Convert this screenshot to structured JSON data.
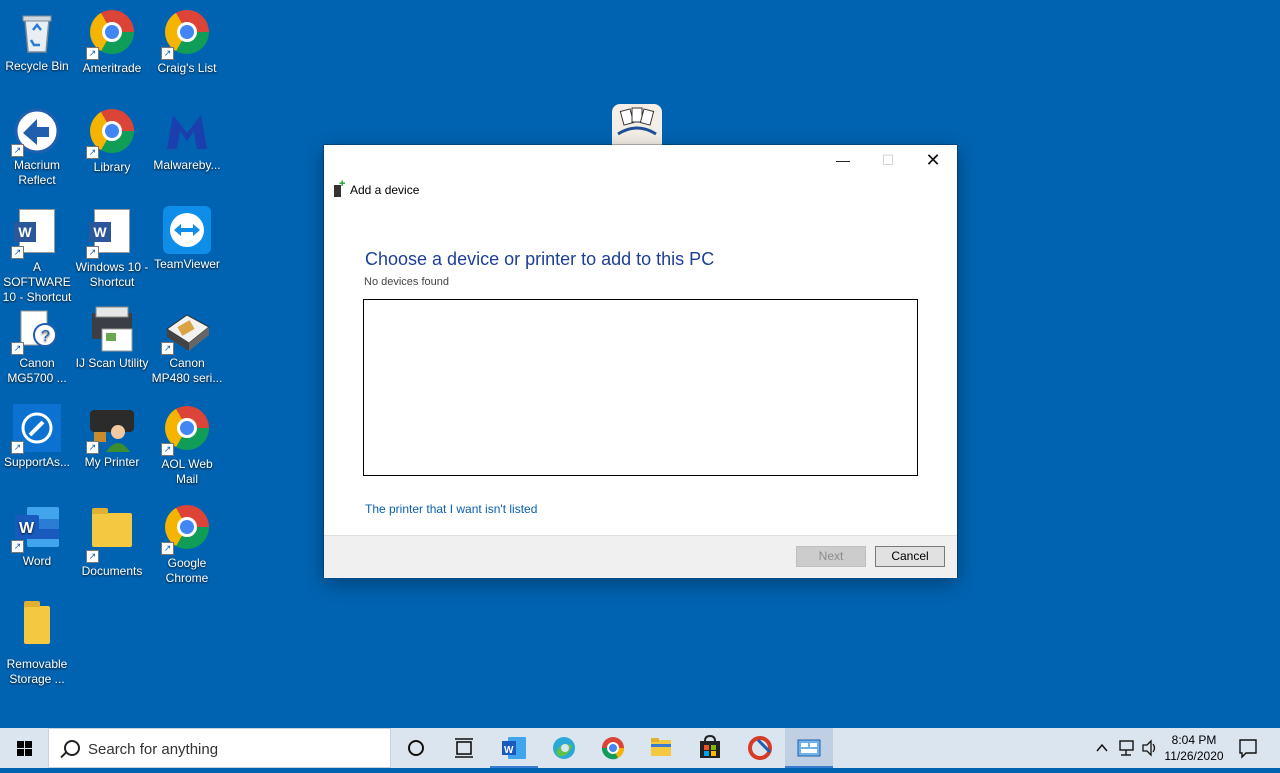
{
  "desktop": {
    "icons": [
      {
        "id": "recycle-bin",
        "label": "Recycle Bin",
        "icon": "recycle-bin-icon"
      },
      {
        "id": "ameritrade",
        "label": "Ameritrade",
        "icon": "chrome-icon"
      },
      {
        "id": "craigs-list",
        "label": "Craig's List",
        "icon": "chrome-icon"
      },
      {
        "id": "macrium-reflect",
        "label": "Macrium Reflect",
        "icon": "macrium-reflect-icon"
      },
      {
        "id": "library",
        "label": "Library",
        "icon": "chrome-icon"
      },
      {
        "id": "malwarebytes",
        "label": "Malwareby...",
        "icon": "malwarebytes-icon"
      },
      {
        "id": "a-software",
        "label": "A SOFTWARE 10 - Shortcut",
        "icon": "word-doc-icon"
      },
      {
        "id": "windows-10",
        "label": "Windows 10 - Shortcut",
        "icon": "word-doc-icon"
      },
      {
        "id": "teamviewer",
        "label": "TeamViewer",
        "icon": "teamviewer-icon"
      },
      {
        "id": "canon-mg5700",
        "label": "Canon MG5700 ...",
        "icon": "canon-printer-icon"
      },
      {
        "id": "ij-scan",
        "label": "IJ Scan Utility",
        "icon": "scanner-icon"
      },
      {
        "id": "canon-mp480",
        "label": "Canon MP480 seri...",
        "icon": "printer-icon"
      },
      {
        "id": "supportassist",
        "label": "SupportAs...",
        "icon": "supportassist-icon"
      },
      {
        "id": "my-printer",
        "label": "My Printer",
        "icon": "my-printer-icon"
      },
      {
        "id": "aol-web-mail",
        "label": "AOL Web Mail",
        "icon": "chrome-icon"
      },
      {
        "id": "word",
        "label": "Word",
        "icon": "word-icon"
      },
      {
        "id": "documents",
        "label": "Documents",
        "icon": "documents-folder-icon"
      },
      {
        "id": "google-chrome",
        "label": "Google Chrome",
        "icon": "chrome-icon"
      },
      {
        "id": "removable-storage",
        "label": "Removable Storage ...",
        "icon": "folder-icon"
      }
    ]
  },
  "dialog": {
    "window_title": "Add a device",
    "heading": "Choose a device or printer to add to this PC",
    "status": "No devices found",
    "link": "The printer that I want isn't listed",
    "next_label": "Next",
    "cancel_label": "Cancel",
    "controls": {
      "minimize": "minimize-icon",
      "maximize": "maximize-icon",
      "close": "close-icon"
    }
  },
  "taskbar": {
    "search_placeholder": "Search for anything",
    "apps": [
      "cortana-icon",
      "task-view-icon",
      "word-icon",
      "edge-icon",
      "chrome-icon",
      "file-explorer-icon",
      "store-icon",
      "ccleaner-icon",
      "control-panel-icon"
    ],
    "clock": {
      "time": "8:04 PM",
      "date": "11/26/2020"
    }
  },
  "colors": {
    "desktop": "#0063b1",
    "heading": "#1d3f99",
    "link": "#0b5fb4",
    "taskbar": "#dbe5f0"
  }
}
